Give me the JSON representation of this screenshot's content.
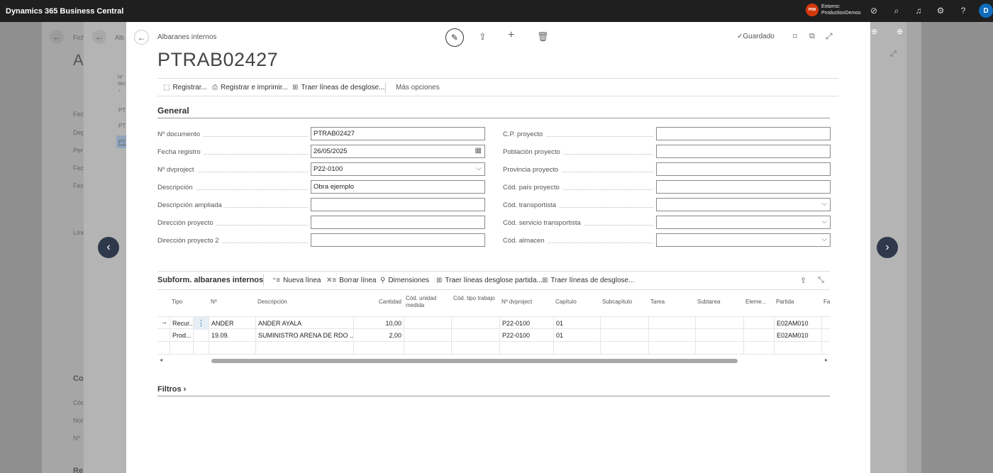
{
  "app": {
    "title": "Dynamics 365 Business Central",
    "env_badge": "PRB",
    "env_label": "Entorno:",
    "env_name": "ProductionDemos",
    "user_initial": "D"
  },
  "background": {
    "crumb1": "Fich",
    "title1": "A",
    "crumb2": "Alb",
    "left_labels": [
      "Fec",
      "Dep",
      "Per",
      "Fec",
      "Fec"
    ],
    "lines_label": "Líne",
    "col2": [
      "Nº",
      "doc",
      "↑"
    ],
    "list": [
      "PT",
      "PT",
      "PT"
    ],
    "co_label": "Co",
    "co_items": [
      "Cód",
      "Nor",
      "Nº"
    ],
    "bottom_label": "Re"
  },
  "page": {
    "breadcrumb": "Albaranes internos",
    "title": "PTRAB02427",
    "saved_label": "Guardado"
  },
  "actions": [
    "Registrar...",
    "Registrar e imprimir...",
    "Traer líneas de desglose...",
    "Más opciones"
  ],
  "general": {
    "title": "General",
    "left": [
      {
        "label": "Nº documento",
        "value": "PTRAB02427",
        "icon": ""
      },
      {
        "label": "Fecha registro",
        "value": "26/05/2025",
        "icon": "calendar-icon"
      },
      {
        "label": "Nº dvproject",
        "value": "P22-0100",
        "icon": "chevron-down-icon"
      },
      {
        "label": "Descripción",
        "value": "Obra ejemplo",
        "icon": ""
      },
      {
        "label": "Descripción ampliada",
        "value": "",
        "icon": ""
      },
      {
        "label": "Dirección proyecto",
        "value": "",
        "icon": ""
      },
      {
        "label": "Dirección proyecto 2",
        "value": "",
        "icon": ""
      }
    ],
    "right": [
      {
        "label": "C.P. proyecto",
        "value": "",
        "icon": ""
      },
      {
        "label": "Población proyecto",
        "value": "",
        "icon": ""
      },
      {
        "label": "Provincia proyecto",
        "value": "",
        "icon": ""
      },
      {
        "label": "Cód. país proyecto",
        "value": "",
        "icon": ""
      },
      {
        "label": "Cód. transportista",
        "value": "",
        "icon": "chevron-down-icon"
      },
      {
        "label": "Cód. servicio transportista",
        "value": "",
        "icon": "chevron-down-icon"
      },
      {
        "label": "Cód. almacen",
        "value": "",
        "icon": "chevron-down-icon"
      }
    ]
  },
  "subform": {
    "title": "Subform. albaranes internos",
    "actions": [
      "Nueva línea",
      "Borrar línea",
      "Dimensiones",
      "Traer líneas desglose partida...",
      "Traer líneas de desglose..."
    ],
    "columns": [
      "Tipo",
      "Nº",
      "Descripción",
      "Cantidad",
      "Cód. unidad medida",
      "Cód. tipo trabajo",
      "Nº dvproject",
      "Capítulo",
      "Subcapítulo",
      "Tarea",
      "Subtarea",
      "Eleme...",
      "Partida",
      "Fa"
    ],
    "rows": [
      {
        "marker": "→",
        "cells": [
          "Recur...",
          "ANDER",
          "ANDER AYALA",
          "10,00",
          "",
          "",
          "P22-0100",
          "01",
          "",
          "",
          "",
          "",
          "E02AM010",
          ""
        ]
      },
      {
        "marker": "",
        "cells": [
          "Prod...",
          "19.09.",
          "SUMINISTRO ARENA DE RDO ...",
          "2,00",
          "",
          "",
          "P22-0100",
          "01",
          "",
          "",
          "",
          "",
          "E02AM010",
          ""
        ]
      },
      {
        "marker": "",
        "cells": [
          "",
          "",
          "",
          "",
          "",
          "",
          "",
          "",
          "",
          "",
          "",
          "",
          "",
          ""
        ]
      }
    ]
  },
  "filtros": {
    "title": "Filtros"
  }
}
